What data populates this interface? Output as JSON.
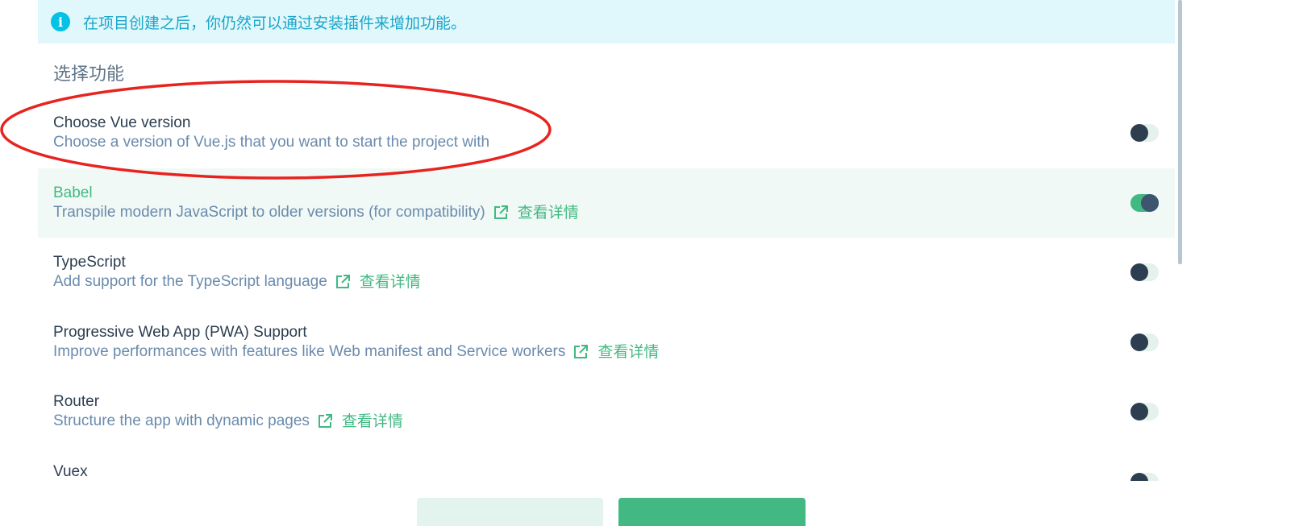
{
  "info_banner": {
    "icon": "info-icon",
    "text": "在项目创建之后，你仍然可以通过安装插件来增加功能。"
  },
  "section_title": "选择功能",
  "more_info_label": "查看详情",
  "features": [
    {
      "name": "Choose Vue version",
      "description": "Choose a version of Vue.js that you want to start the project with",
      "enabled": false,
      "has_link": false
    },
    {
      "name": "Babel",
      "description": "Transpile modern JavaScript to older versions (for compatibility)",
      "enabled": true,
      "has_link": true
    },
    {
      "name": "TypeScript",
      "description": "Add support for the TypeScript language",
      "enabled": false,
      "has_link": true
    },
    {
      "name": "Progressive Web App (PWA) Support",
      "description": "Improve performances with features like Web manifest and Service workers",
      "enabled": false,
      "has_link": true
    },
    {
      "name": "Router",
      "description": "Structure the app with dynamic pages",
      "enabled": false,
      "has_link": true
    },
    {
      "name": "Vuex",
      "description": "",
      "enabled": false,
      "has_link": false
    }
  ],
  "colors": {
    "accent": "#42b983",
    "banner_bg": "#e0f7fc",
    "banner_text": "#1aa6c9",
    "annotation": "#e8231f"
  }
}
